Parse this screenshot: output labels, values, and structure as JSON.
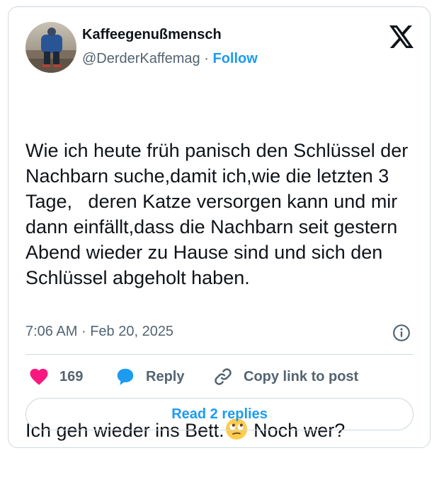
{
  "author": {
    "display_name": "Kaffeegenußmensch",
    "handle": "@DerderKaffemag",
    "separator": "·",
    "follow_label": "Follow"
  },
  "tweet": {
    "paragraph_1": "Wie ich heute früh panisch den Schlüssel der Nachbarn suche,damit ich,wie die letzten 3 Tage,   deren Katze versorgen kann und mir dann einfällt,dass die Nachbarn seit gestern Abend wieder zu Hause sind und sich den Schlüssel abgeholt haben.",
    "paragraph_2_before_emoji": "Ich geh wieder ins Bett.",
    "emoji": "face-with-rolling-eyes",
    "paragraph_2_after_emoji": " Noch wer?"
  },
  "meta": {
    "time": "7:06 AM",
    "separator": "·",
    "date": "Feb 20, 2025"
  },
  "actions": {
    "like_count": "169",
    "reply_label": "Reply",
    "copy_label": "Copy link to post"
  },
  "footer": {
    "read_replies_label": "Read 2 replies"
  },
  "colors": {
    "accent": "#1d9bf0",
    "like": "#f91880",
    "text": "#0f1419",
    "muted": "#536471",
    "border": "#cfd9de"
  },
  "icons": [
    "x-logo-icon",
    "info-icon",
    "heart-icon",
    "reply-bubble-icon",
    "link-icon"
  ]
}
